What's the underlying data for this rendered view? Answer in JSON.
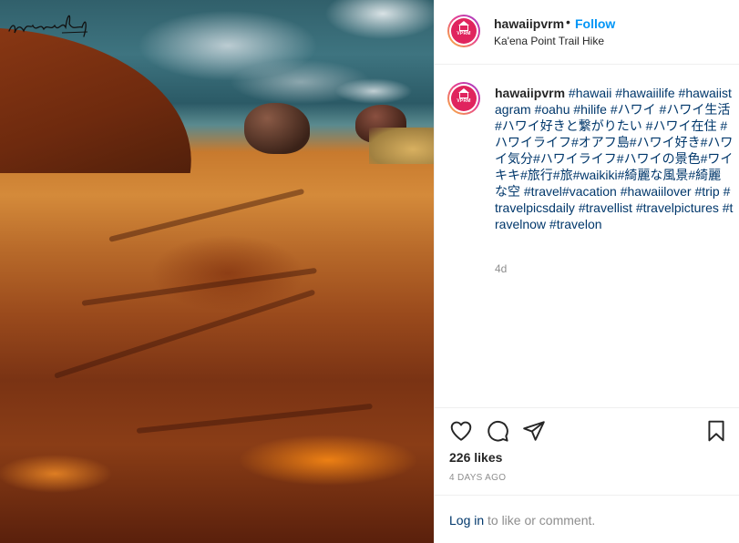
{
  "post": {
    "username": "hawaiipvrm",
    "separator": "•",
    "follow_label": "Follow",
    "location": "Ka'ena Point Trail Hike",
    "avatar_logo_text": "VPRM",
    "more_options": "···"
  },
  "caption": {
    "username": "hawaiipvrm",
    "text": "#hawaii #hawaiilife #hawaiistagram #oahu #hilife #ハワイ #ハワイ生活 #ハワイ好きと繋がりたい #ハワイ在住 #ハワイライフ#オアフ島#ハワイ好き#ハワイ気分#ハワイライフ#ハワイの景色#ワイキキ#旅行#旅#waikiki#綺麗な風景#綺麗な空 #travel#vacation #hawaiilover #trip #travelpicsdaily #travellist #travelpictures #travelnow #travelon",
    "time_ago": "4d"
  },
  "actions": {
    "like_icon": "heart-icon",
    "comment_icon": "comment-icon",
    "share_icon": "share-icon",
    "save_icon": "bookmark-icon",
    "likes_text": "226 likes",
    "timestamp": "4 DAYS AGO"
  },
  "comment": {
    "login_label": "Log in",
    "rest_text": "to like or comment."
  },
  "image": {
    "signature_watermark": "photographer-signature"
  },
  "colors": {
    "link_blue": "#0095f6",
    "hashtag": "#00376b",
    "muted": "#8e8e8e",
    "text": "#262626",
    "avatar_bg": "#e0245e"
  }
}
